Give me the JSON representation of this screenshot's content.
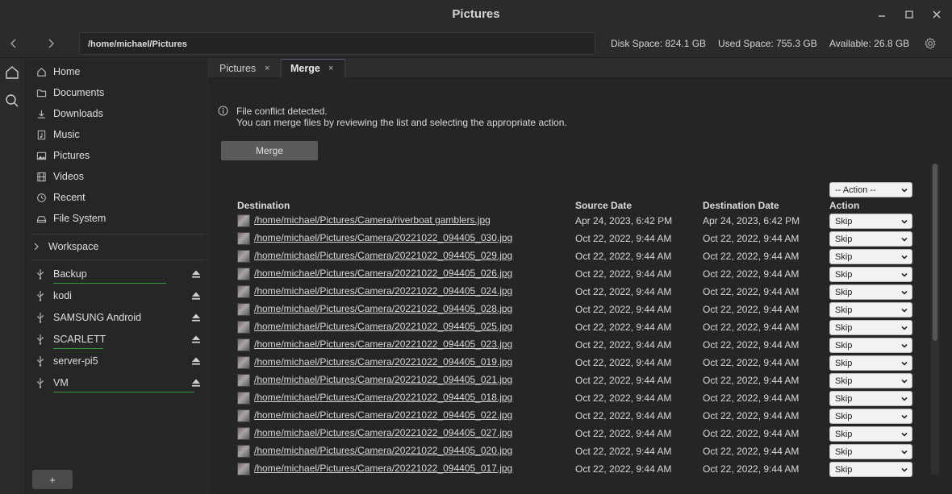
{
  "window": {
    "title": "Pictures"
  },
  "toolbar": {
    "path": "/home/michael/Pictures",
    "disk_space": "Disk Space: 824.1 GB",
    "used_space": "Used Space: 755.3 GB",
    "available": "Available: 26.8 GB"
  },
  "sidebar": {
    "places": [
      {
        "label": "Home",
        "icon": "home-icon"
      },
      {
        "label": "Documents",
        "icon": "folder-icon"
      },
      {
        "label": "Downloads",
        "icon": "download-icon"
      },
      {
        "label": "Music",
        "icon": "music-icon"
      },
      {
        "label": "Pictures",
        "icon": "image-icon"
      },
      {
        "label": "Videos",
        "icon": "film-icon"
      },
      {
        "label": "Recent",
        "icon": "clock-icon"
      },
      {
        "label": "File System",
        "icon": "drive-icon"
      }
    ],
    "workspace_label": "Workspace",
    "devices": [
      {
        "label": "Backup"
      },
      {
        "label": "kodi"
      },
      {
        "label": "SAMSUNG Android"
      },
      {
        "label": "SCARLETT"
      },
      {
        "label": "server-pi5"
      },
      {
        "label": "VM"
      }
    ],
    "add_label": "+"
  },
  "tabs": [
    {
      "label": "Pictures",
      "close": "×"
    },
    {
      "label": "Merge",
      "close": "×"
    }
  ],
  "merge": {
    "notice_line1": "File conflict detected.",
    "notice_line2": "You can merge files by reviewing the list and selecting the appropriate action.",
    "merge_button": "Merge",
    "bulk_action": "-- Action --",
    "headers": {
      "destination": "Destination",
      "source_date": "Source Date",
      "destination_date": "Destination Date",
      "action": "Action"
    },
    "rows": [
      {
        "path": "/home/michael/Pictures/Camera/riverboat gamblers.jpg",
        "source_date": "Apr 24, 2023, 6:42 PM",
        "destination_date": "Apr 24, 2023, 6:42 PM",
        "action": "Skip"
      },
      {
        "path": "/home/michael/Pictures/Camera/20221022_094405_030.jpg",
        "source_date": "Oct 22, 2022, 9:44 AM",
        "destination_date": "Oct 22, 2022, 9:44 AM",
        "action": "Skip"
      },
      {
        "path": "/home/michael/Pictures/Camera/20221022_094405_029.jpg",
        "source_date": "Oct 22, 2022, 9:44 AM",
        "destination_date": "Oct 22, 2022, 9:44 AM",
        "action": "Skip"
      },
      {
        "path": "/home/michael/Pictures/Camera/20221022_094405_026.jpg",
        "source_date": "Oct 22, 2022, 9:44 AM",
        "destination_date": "Oct 22, 2022, 9:44 AM",
        "action": "Skip"
      },
      {
        "path": "/home/michael/Pictures/Camera/20221022_094405_024.jpg",
        "source_date": "Oct 22, 2022, 9:44 AM",
        "destination_date": "Oct 22, 2022, 9:44 AM",
        "action": "Skip"
      },
      {
        "path": "/home/michael/Pictures/Camera/20221022_094405_028.jpg",
        "source_date": "Oct 22, 2022, 9:44 AM",
        "destination_date": "Oct 22, 2022, 9:44 AM",
        "action": "Skip"
      },
      {
        "path": "/home/michael/Pictures/Camera/20221022_094405_025.jpg",
        "source_date": "Oct 22, 2022, 9:44 AM",
        "destination_date": "Oct 22, 2022, 9:44 AM",
        "action": "Skip"
      },
      {
        "path": "/home/michael/Pictures/Camera/20221022_094405_023.jpg",
        "source_date": "Oct 22, 2022, 9:44 AM",
        "destination_date": "Oct 22, 2022, 9:44 AM",
        "action": "Skip"
      },
      {
        "path": "/home/michael/Pictures/Camera/20221022_094405_019.jpg",
        "source_date": "Oct 22, 2022, 9:44 AM",
        "destination_date": "Oct 22, 2022, 9:44 AM",
        "action": "Skip"
      },
      {
        "path": "/home/michael/Pictures/Camera/20221022_094405_021.jpg",
        "source_date": "Oct 22, 2022, 9:44 AM",
        "destination_date": "Oct 22, 2022, 9:44 AM",
        "action": "Skip"
      },
      {
        "path": "/home/michael/Pictures/Camera/20221022_094405_018.jpg",
        "source_date": "Oct 22, 2022, 9:44 AM",
        "destination_date": "Oct 22, 2022, 9:44 AM",
        "action": "Skip"
      },
      {
        "path": "/home/michael/Pictures/Camera/20221022_094405_022.jpg",
        "source_date": "Oct 22, 2022, 9:44 AM",
        "destination_date": "Oct 22, 2022, 9:44 AM",
        "action": "Skip"
      },
      {
        "path": "/home/michael/Pictures/Camera/20221022_094405_027.jpg",
        "source_date": "Oct 22, 2022, 9:44 AM",
        "destination_date": "Oct 22, 2022, 9:44 AM",
        "action": "Skip"
      },
      {
        "path": "/home/michael/Pictures/Camera/20221022_094405_020.jpg",
        "source_date": "Oct 22, 2022, 9:44 AM",
        "destination_date": "Oct 22, 2022, 9:44 AM",
        "action": "Skip"
      },
      {
        "path": "/home/michael/Pictures/Camera/20221022_094405_017.jpg",
        "source_date": "Oct 22, 2022, 9:44 AM",
        "destination_date": "Oct 22, 2022, 9:44 AM",
        "action": "Skip"
      }
    ]
  },
  "colors": {
    "device_bar": "#2f9a3c",
    "background": "#2b2b2b"
  }
}
